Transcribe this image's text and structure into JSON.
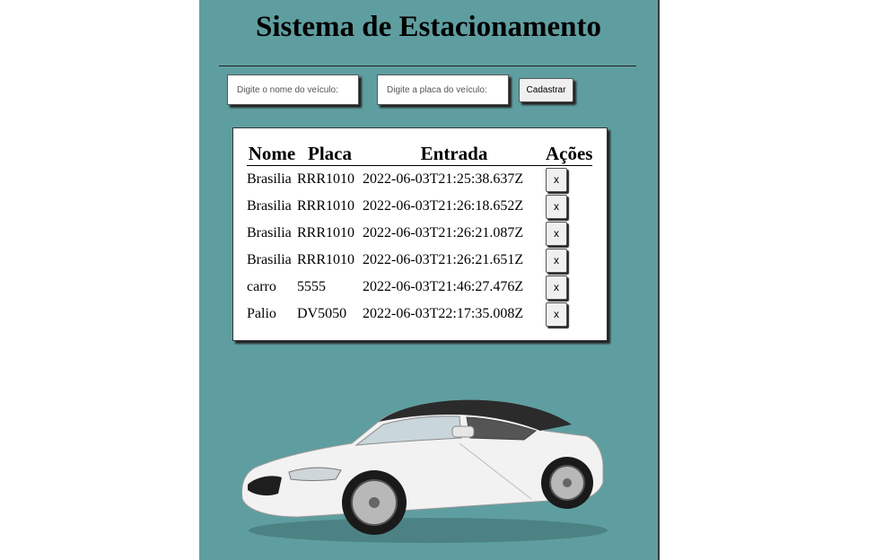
{
  "header": {
    "title": "Sistema de Estacionamento"
  },
  "form": {
    "nome_placeholder": "Digite o nome do veículo:",
    "placa_placeholder": "Digite a placa do veículo:",
    "submit_label": "Cadastrar"
  },
  "table": {
    "headers": [
      "Nome",
      "Placa",
      "Entrada",
      "Ações"
    ],
    "rows": [
      {
        "nome": "Brasilia",
        "placa": "RRR1010",
        "entrada": "2022-06-03T21:25:38.637Z",
        "acao": "x"
      },
      {
        "nome": "Brasilia",
        "placa": "RRR1010",
        "entrada": "2022-06-03T21:26:18.652Z",
        "acao": "x"
      },
      {
        "nome": "Brasilia",
        "placa": "RRR1010",
        "entrada": "2022-06-03T21:26:21.087Z",
        "acao": "x"
      },
      {
        "nome": "Brasilia",
        "placa": "RRR1010",
        "entrada": "2022-06-03T21:26:21.651Z",
        "acao": "x"
      },
      {
        "nome": "carro",
        "placa": "5555",
        "entrada": "2022-06-03T21:46:27.476Z",
        "acao": "x"
      },
      {
        "nome": "Palio",
        "placa": "DV5050",
        "entrada": "2022-06-03T22:17:35.008Z",
        "acao": "x"
      }
    ]
  },
  "colors": {
    "background": "#5f9ea0",
    "car_body": "#f2f2f2",
    "car_roof": "#2b2b2b"
  }
}
